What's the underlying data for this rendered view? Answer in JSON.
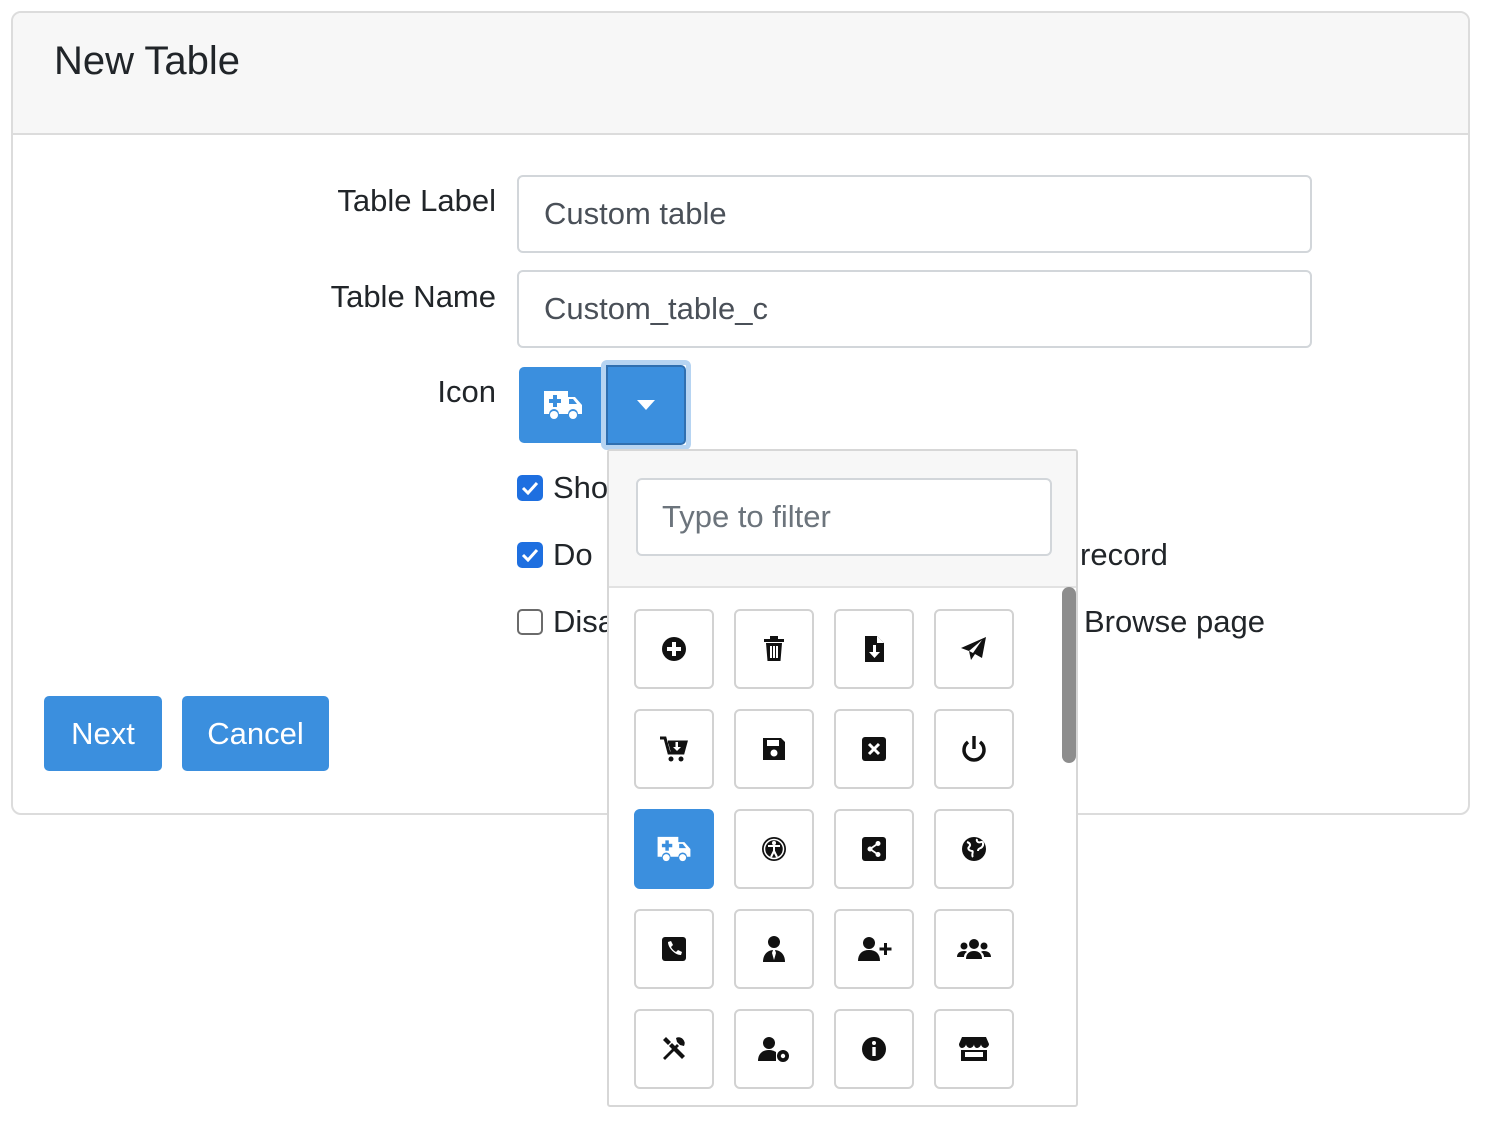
{
  "card": {
    "title": "New Table"
  },
  "form": {
    "table_label": {
      "label": "Table Label",
      "value": "Custom table"
    },
    "table_name": {
      "label": "Table Name",
      "value": "Custom_table_c"
    },
    "icon": {
      "label": "Icon",
      "selected_icon": "ambulance-icon"
    },
    "checkboxes": [
      {
        "visible_text": "Sho",
        "checked": true
      },
      {
        "visible_text_start": "Do ",
        "visible_text_end": "record",
        "checked": true
      },
      {
        "visible_text_start": "Disa",
        "visible_text_end": "Browse page",
        "checked": false
      }
    ]
  },
  "buttons": {
    "next": "Next",
    "cancel": "Cancel"
  },
  "icon_picker": {
    "filter_placeholder": "Type to filter",
    "icons": [
      "plus-circle-icon",
      "trash-icon",
      "file-download-icon",
      "paper-plane-icon",
      "cart-download-icon",
      "save-icon",
      "close-box-icon",
      "power-icon",
      "ambulance-icon",
      "accessibility-icon",
      "share-square-icon",
      "globe-icon",
      "phone-square-icon",
      "user-tie-icon",
      "user-plus-icon",
      "users-icon",
      "tools-icon",
      "user-cog-icon",
      "info-circle-icon",
      "store-icon"
    ],
    "selected_index": 8
  },
  "colors": {
    "primary": "#3b8fde",
    "checkbox": "#1e6fe0",
    "header_bg": "#f7f7f7"
  }
}
